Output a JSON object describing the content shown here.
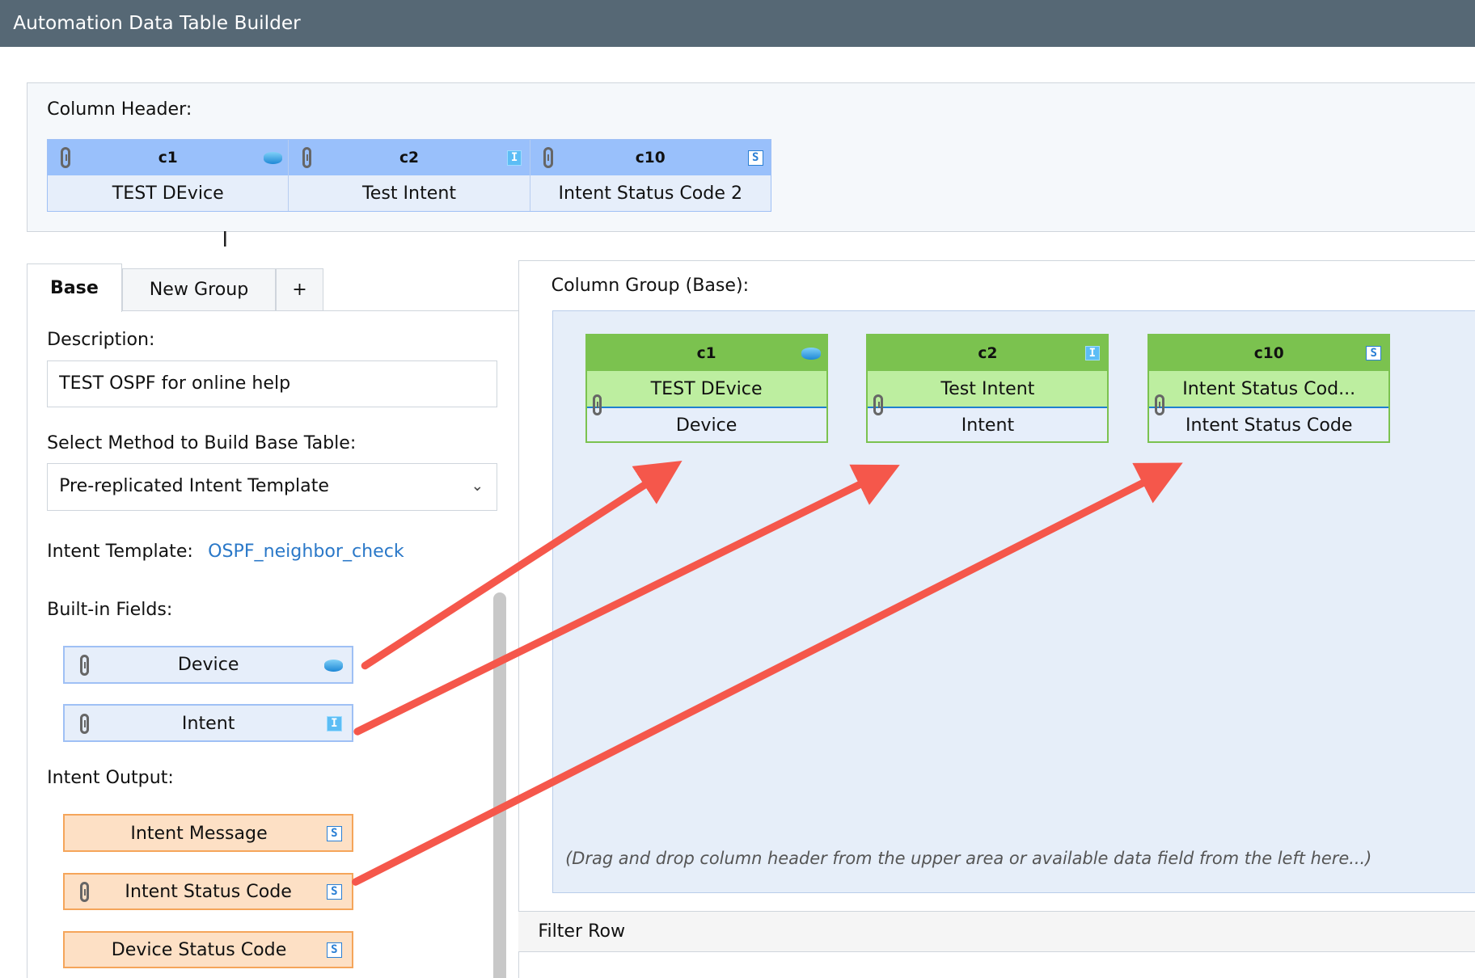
{
  "window": {
    "title": "Automation Data Table Builder"
  },
  "column_header": {
    "label": "Column Header:",
    "columns": [
      {
        "id": "c1",
        "name": "TEST DEvice",
        "type_icon": "router-icon"
      },
      {
        "id": "c2",
        "name": "Test Intent",
        "type_icon": "intent-type-icon"
      },
      {
        "id": "c10",
        "name": "Intent Status Code 2",
        "type_icon": "string-type-icon"
      }
    ]
  },
  "tabs": [
    {
      "label": "Base",
      "active": true
    },
    {
      "label": "New Group"
    },
    {
      "label": "+"
    }
  ],
  "left": {
    "description_label": "Description:",
    "description_value": "TEST OSPF for online help",
    "method_label": "Select Method to Build Base Table:",
    "method_value": "Pre-replicated Intent Template",
    "template_label": "Intent Template:",
    "template_link": "OSPF_neighbor_check",
    "builtin_label": "Built-in Fields:",
    "builtin_fields": [
      {
        "name": "Device",
        "type_icon": "router-icon"
      },
      {
        "name": "Intent",
        "type_icon": "intent-type-icon"
      }
    ],
    "output_label": "Intent Output:",
    "output_fields": [
      {
        "name": "Intent Message",
        "type_icon": "string-type-icon"
      },
      {
        "name": "Intent Status Code",
        "type_icon": "string-type-icon"
      },
      {
        "name": "Device Status Code",
        "type_icon": "string-type-icon"
      }
    ]
  },
  "right": {
    "group_label": "Column Group (Base):",
    "cards": [
      {
        "id": "c1",
        "name": "TEST DEvice",
        "field": "Device"
      },
      {
        "id": "c2",
        "name": "Test Intent",
        "field": "Intent"
      },
      {
        "id": "c10",
        "name": "Intent Status Cod...",
        "field": "Intent Status Code"
      }
    ],
    "hint": "(Drag and drop column header from the upper area or available data field from the left here...)",
    "filter_row": "Filter Row"
  },
  "colors": {
    "titlebar": "#566875",
    "header_blue": "#99c0fb",
    "card_green": "#7bc24f",
    "output_orange": "#fde0c5",
    "arrow": "#f5574b",
    "link": "#2a78c8"
  }
}
